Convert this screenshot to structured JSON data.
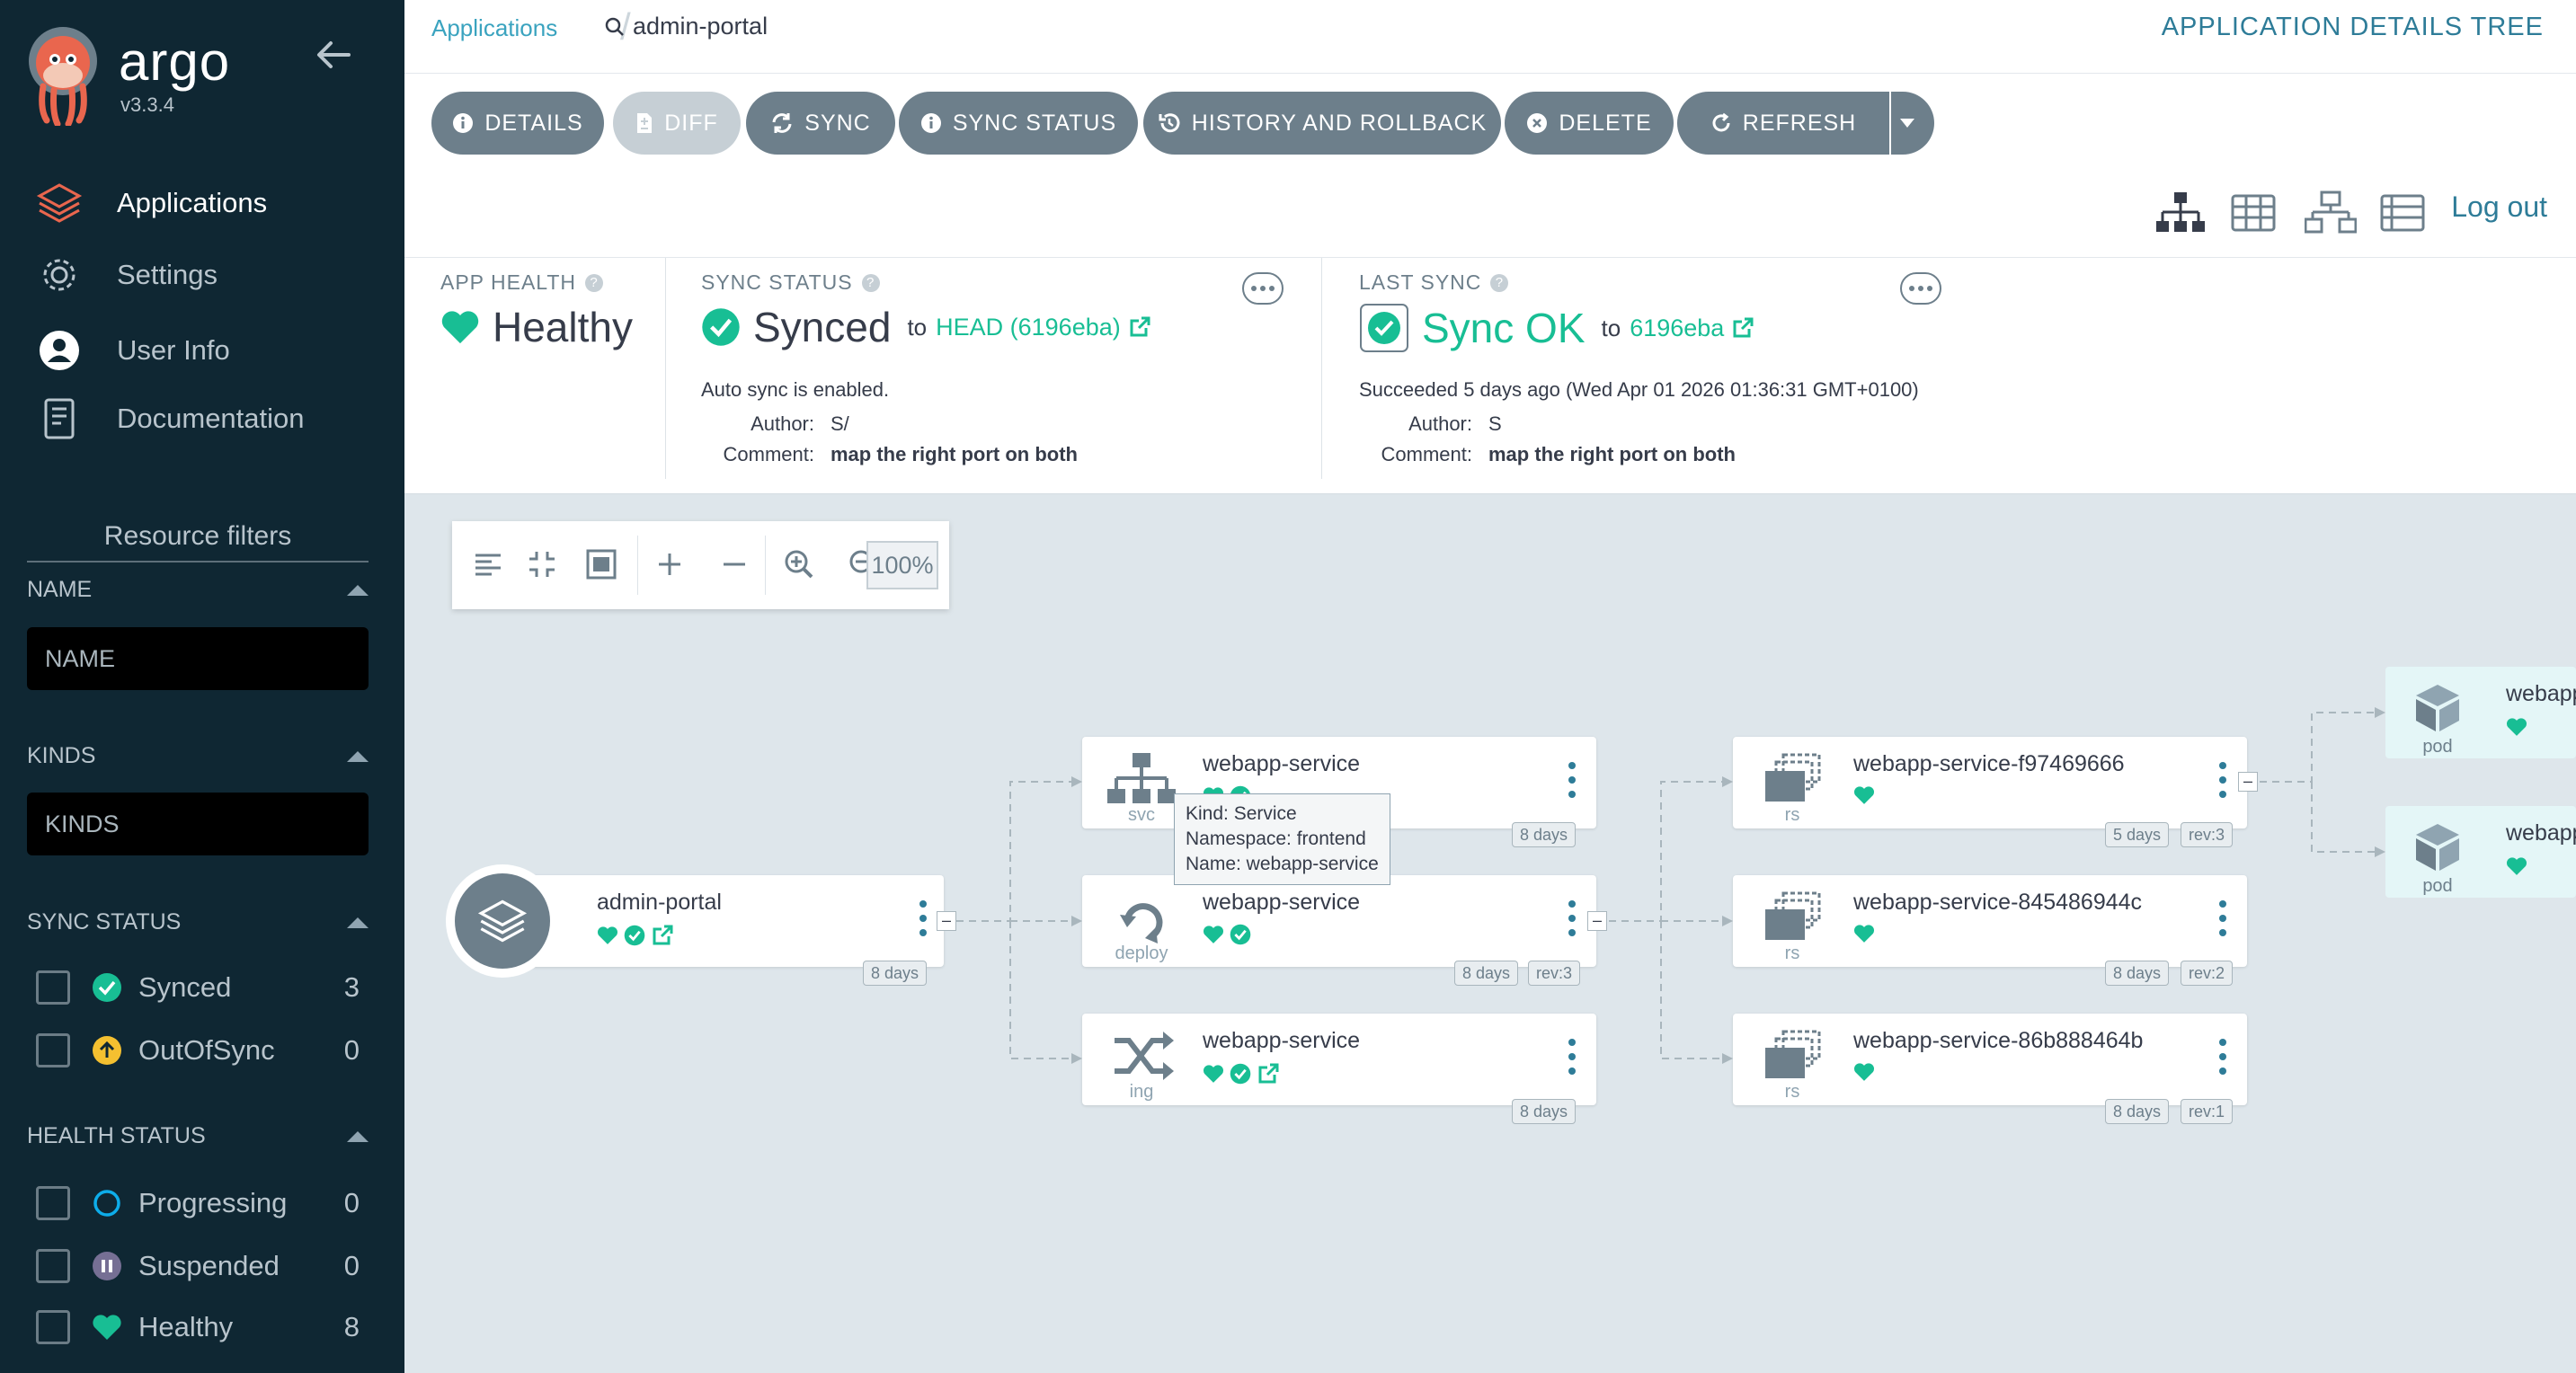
{
  "brand": {
    "name": "argo",
    "version": "v3.3.4"
  },
  "nav": [
    {
      "label": "Applications",
      "icon": "applications-icon",
      "active": true
    },
    {
      "label": "Settings",
      "icon": "settings-icon"
    },
    {
      "label": "User Info",
      "icon": "user-info-icon"
    },
    {
      "label": "Documentation",
      "icon": "documentation-icon"
    }
  ],
  "filters": {
    "title": "Resource filters",
    "name": {
      "label": "NAME",
      "placeholder": "NAME"
    },
    "kinds": {
      "label": "KINDS",
      "placeholder": "KINDS"
    },
    "sync_status": {
      "label": "SYNC STATUS",
      "items": [
        {
          "label": "Synced",
          "count": "3"
        },
        {
          "label": "OutOfSync",
          "count": "0"
        }
      ]
    },
    "health_status": {
      "label": "HEALTH STATUS",
      "items": [
        {
          "label": "Progressing",
          "count": "0"
        },
        {
          "label": "Suspended",
          "count": "0"
        },
        {
          "label": "Healthy",
          "count": "8"
        }
      ]
    }
  },
  "breadcrumb": {
    "root": "Applications",
    "current": "admin-portal"
  },
  "page_title": "APPLICATION DETAILS TREE",
  "toolbar": {
    "details": "DETAILS",
    "diff": "DIFF",
    "sync": "SYNC",
    "sync_status": "SYNC STATUS",
    "history": "HISTORY AND ROLLBACK",
    "delete": "DELETE",
    "refresh": "REFRESH"
  },
  "logout": "Log out",
  "app_health": {
    "label": "APP HEALTH",
    "value": "Healthy"
  },
  "sync_panel": {
    "label": "SYNC STATUS",
    "value": "Synced",
    "to": "to",
    "revision": "HEAD (6196eba)",
    "note": "Auto sync is enabled.",
    "author_key": "Author:",
    "author": "S/",
    "comment_key": "Comment:",
    "comment": "map the right port on both"
  },
  "last_sync": {
    "label": "LAST SYNC",
    "value": "Sync OK",
    "to": "to",
    "revision": "6196eba",
    "note": "Succeeded 5 days ago (Wed Apr 01 2026 01:36:31 GMT+0100)",
    "author_key": "Author:",
    "author": "S",
    "comment_key": "Comment:",
    "comment": "map the right port on both"
  },
  "graph": {
    "zoom": "100%",
    "app_node": {
      "name": "admin-portal",
      "age": "8 days"
    },
    "svc_node": {
      "name": "webapp-service",
      "kind": "svc",
      "age": "8 days"
    },
    "deploy_node": {
      "name": "webapp-service",
      "kind": "deploy",
      "age": "8 days",
      "rev": "rev:3"
    },
    "ing_node": {
      "name": "webapp-service",
      "kind": "ing",
      "age": "8 days"
    },
    "rs_nodes": [
      {
        "name": "webapp-service-f97469666",
        "kind": "rs",
        "age": "5 days",
        "rev": "rev:3"
      },
      {
        "name": "webapp-service-845486944c",
        "kind": "rs",
        "age": "8 days",
        "rev": "rev:2"
      },
      {
        "name": "webapp-service-86b888464b",
        "kind": "rs",
        "age": "8 days",
        "rev": "rev:1"
      }
    ],
    "pod_nodes": [
      {
        "name": "webapp",
        "kind": "pod"
      },
      {
        "name": "webapp",
        "kind": "pod"
      }
    ],
    "tooltip": {
      "kind": "Kind: Service",
      "namespace": "Namespace: frontend",
      "name": "Name: webapp-service"
    }
  },
  "colors": {
    "sidebar": "#0f2733",
    "healthy": "#18be94",
    "accent": "#2e7c98",
    "button": "#6d7f8b"
  }
}
